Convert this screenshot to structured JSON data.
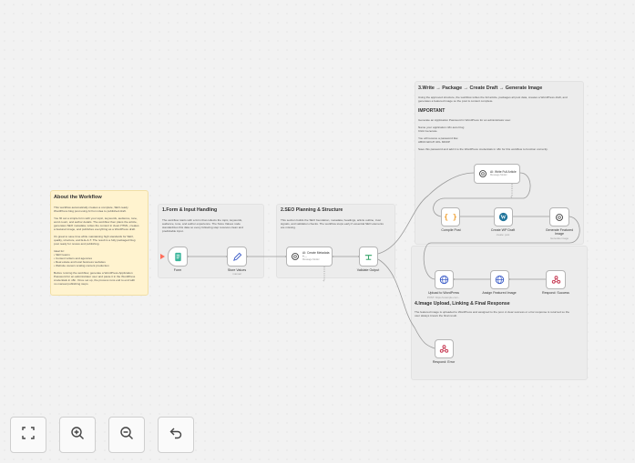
{
  "about": {
    "title": "About the Workflow",
    "lines": [
      "This workflow automatically creates a complete, SEO-ready",
      "WordPress blog post using AI from idea to published draft.",
      "",
      "You fill out a simple form with your topic, keywords, audience, tone,",
      "word count, and author details. The workflow then plans the article,",
      "generates SEO metadata, writes the content in clean HTML, creates",
      "a featured image, and publishes everything as a WordPress draft.",
      "",
      "It's great to save time while maintaining high standards for SEO,",
      "quality, structure, and E-E-A-T. The result is a fully packaged blog",
      "post ready for review and publishing.",
      "",
      "Ideal for:",
      "• SEO teams",
      "• Content writers and agencies",
      "• Real estate and local business websites",
      "• Website owners scaling content production",
      "",
      "Before running the workflow, generate a WordPress Application",
      "Password for an administrator user and paste it in the WordPress",
      "credentials in n8n. Once set up, the process runs end to end with",
      "no manual publishing steps."
    ]
  },
  "section1": {
    "title": "1.Form & Input Handling",
    "lines": [
      "The workflow starts with a form that collects the topic, keywords,",
      "audience, tone, and author experience. The Store Values node",
      "standardizes this data so every following step receives clean and",
      "predictable input."
    ]
  },
  "section2": {
    "title": "2.SEO Planning & Structure",
    "lines": [
      "This section builds the SEO foundation, metadata, headings, article outline, trust",
      "signals, and validation checks. The workflow stops early if essential SEO elements",
      "are missing."
    ]
  },
  "section3": {
    "title": "3.Write → Package → Create Draft → Generate Image",
    "lines": [
      "Using the approved structure, the workflow writes the full article, packages all post data, creates a WordPress draft, and",
      "generates a featured image so the post is content complete."
    ],
    "important_title": "IMPORTANT",
    "important_lines": [
      "Generate an Application Password in WordPress for an administrator user.",
      "",
      "Name your application n8n auto blog",
      "Click Generate.",
      "",
      "You will receive a password like:",
      "ABCD EFGH IJKL MNOP",
      "",
      "Save this password and add it to the WordPress credentials in n8n for this workflow to function correctly."
    ]
  },
  "section4": {
    "title": "4.Image Upload, Linking & Final Response",
    "lines": [
      "The featured image is uploaded to WordPress and assigned to the post. A clear success or error response is returned so the",
      "user always knows the final result."
    ]
  },
  "nodes": {
    "form": {
      "label": "Form",
      "icon": "form-icon"
    },
    "store": {
      "label": "Store Values",
      "sub": "manual",
      "icon": "pencil-icon"
    },
    "metadata": {
      "label": "AI: Create Metadata +...",
      "sub": "Message Model",
      "icon": "openai-icon"
    },
    "validate": {
      "label": "Validate Output",
      "icon": "filter-icon"
    },
    "write": {
      "label": "AI: Write Full Article",
      "sub": "Message Model",
      "icon": "openai-icon"
    },
    "compile": {
      "label": "Compile Post",
      "icon": "code-icon"
    },
    "create_wp": {
      "label": "Create WP Draft",
      "sub": "create: post",
      "icon": "wordpress-icon"
    },
    "gen_image": {
      "label": "Generate Featured Image",
      "sub": "Generate image",
      "icon": "openai-icon"
    },
    "upload": {
      "label": "Upload to WordPress",
      "sub": "POST: https://example.com...",
      "icon": "globe-icon"
    },
    "assign": {
      "label": "Assign Featured Image",
      "icon": "globe-icon"
    },
    "success": {
      "label": "Respond: Success",
      "icon": "webhook-icon"
    },
    "error": {
      "label": "Respond: Error",
      "icon": "webhook-icon"
    }
  },
  "controls": {
    "fit": "fit-view-icon",
    "zoom_in": "zoom-in-icon",
    "zoom_out": "zoom-out-icon",
    "undo": "undo-icon"
  },
  "colors": {
    "note_yellow": "#fff3cf",
    "note_gray": "#ececec",
    "trigger_orange": "#ff6d5a",
    "wordpress_blue": "#21759b",
    "http_blue": "#3a5bc7",
    "code_orange": "#f0a030",
    "webhook_red": "#c4314b"
  }
}
